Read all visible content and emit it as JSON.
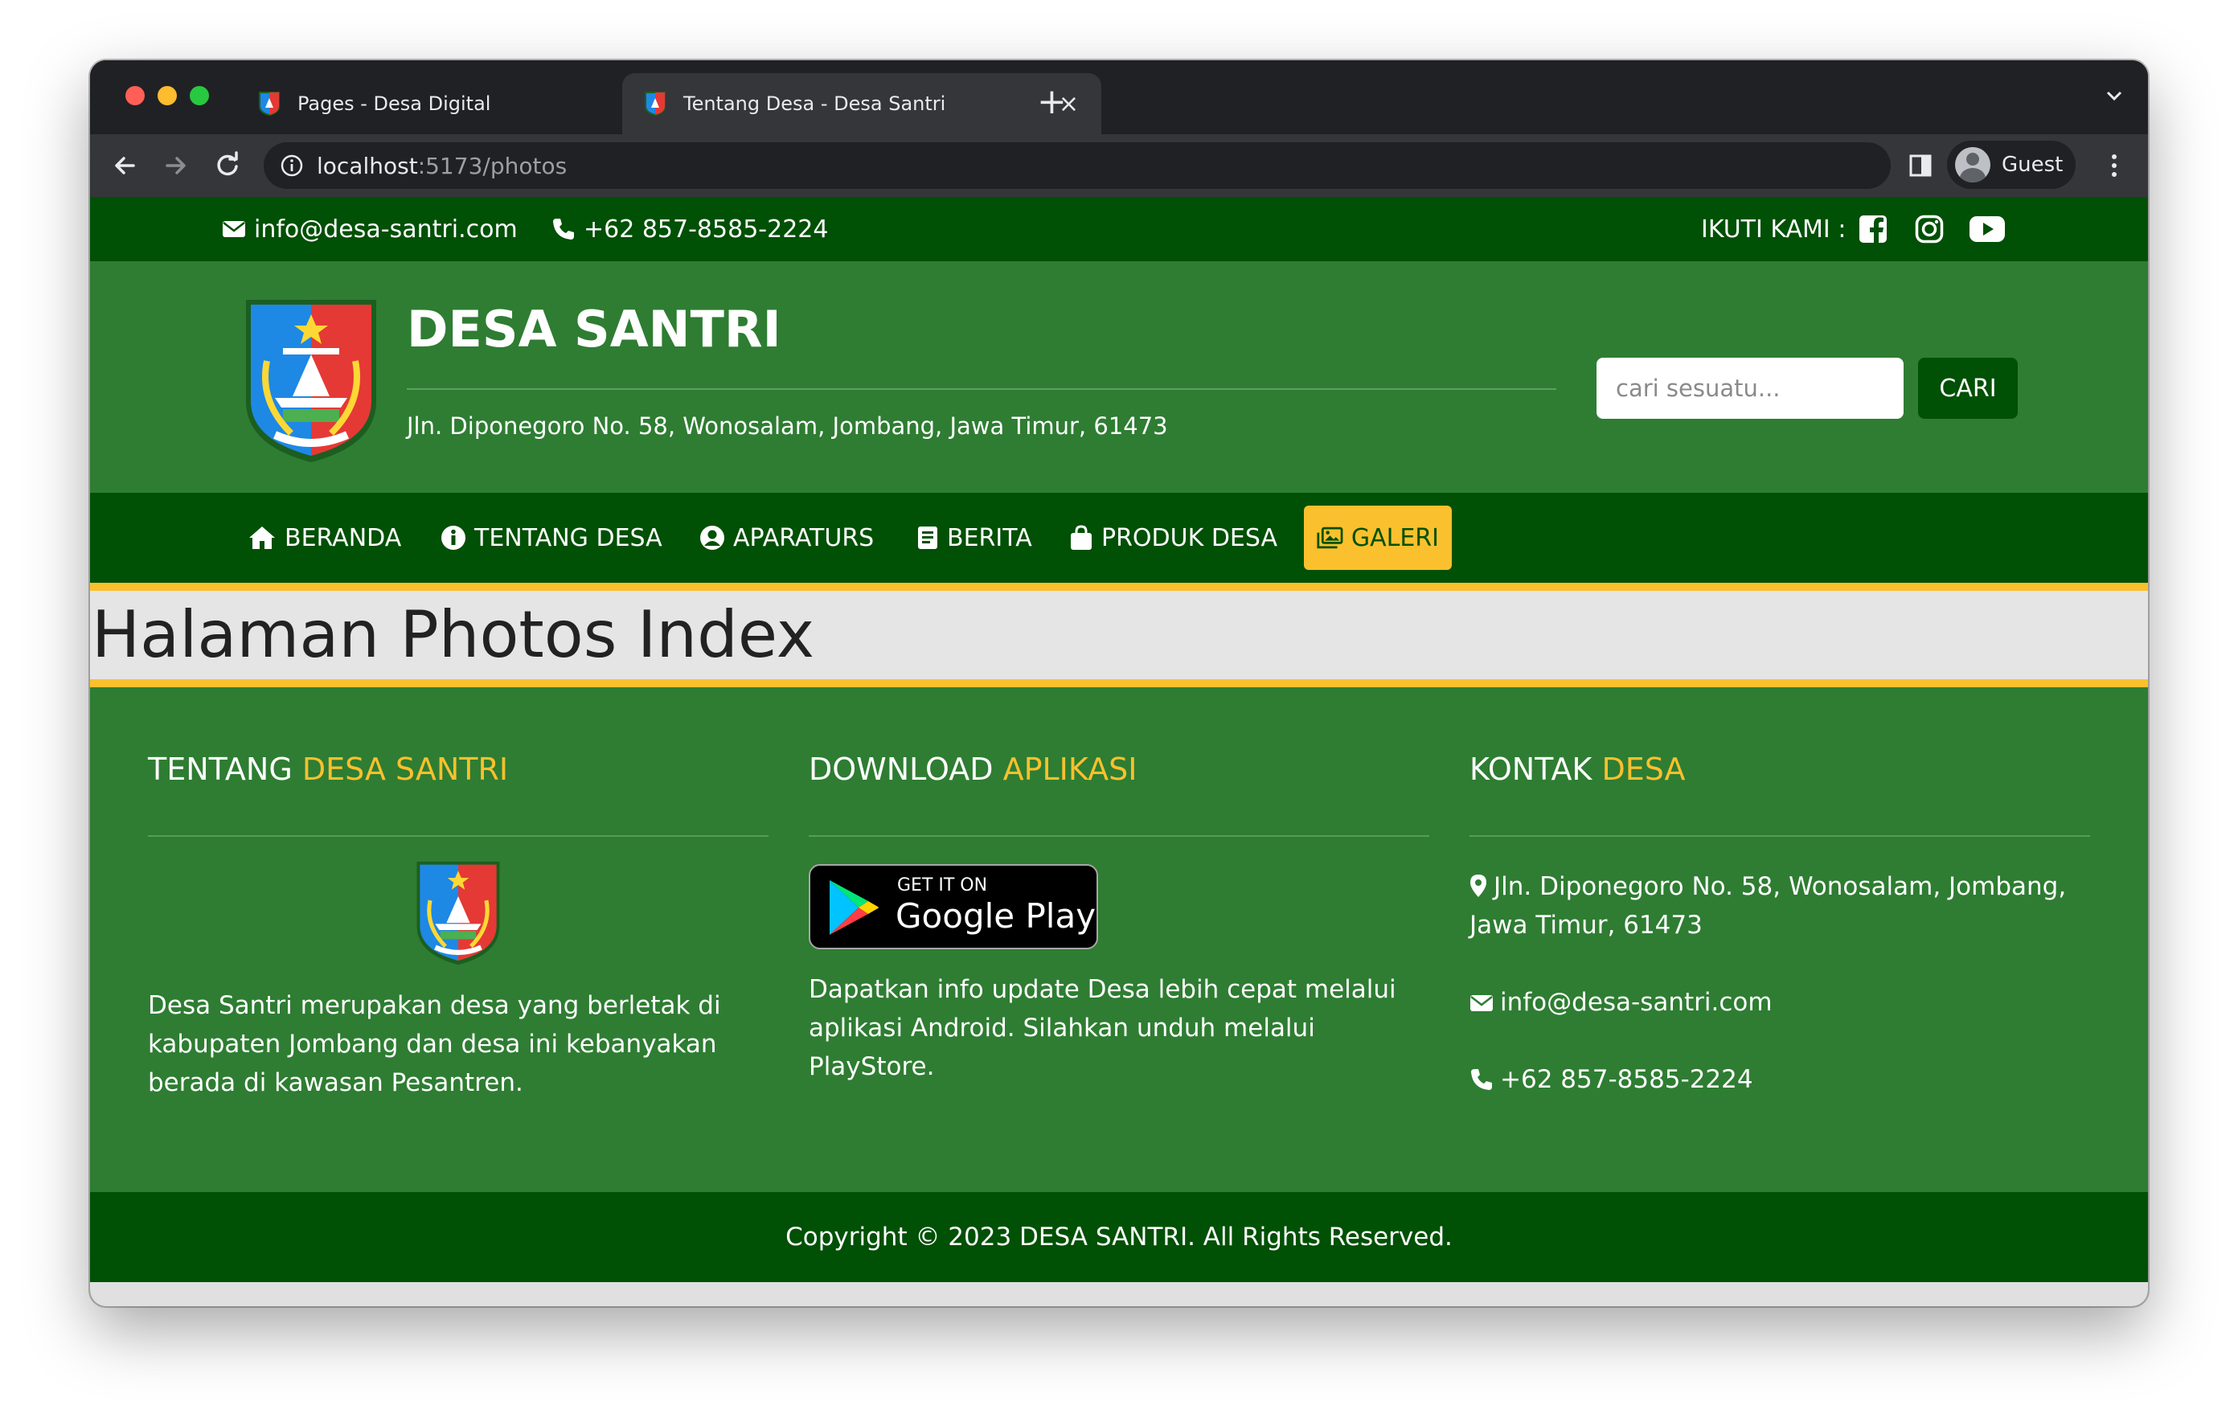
{
  "browser": {
    "tabs": [
      {
        "title": "Pages - Desa Digital"
      },
      {
        "title": "Tentang Desa - Desa Santri"
      }
    ],
    "url_host": "localhost",
    "url_path": ":5173/photos",
    "profile_name": "Guest"
  },
  "topbar": {
    "email": "info@desa-santri.com",
    "phone": "+62 857-8585-2224",
    "follow_label": "IKUTI KAMI :"
  },
  "header": {
    "site_name": "DESA SANTRI",
    "address": "Jln. Diponegoro No. 58, Wonosalam, Jombang, Jawa Timur, 61473",
    "search_placeholder": "cari sesuatu...",
    "search_button": "CARI"
  },
  "nav": {
    "items": [
      {
        "label": "BERANDA",
        "icon": "home-icon"
      },
      {
        "label": "TENTANG DESA",
        "icon": "info-icon"
      },
      {
        "label": "APARATURS",
        "icon": "user-circle-icon"
      },
      {
        "label": "BERITA",
        "icon": "newspaper-icon"
      },
      {
        "label": "PRODUK DESA",
        "icon": "shopping-bag-icon"
      },
      {
        "label": "GALERI",
        "icon": "images-icon",
        "active": true
      }
    ]
  },
  "main": {
    "title": "Halaman Photos Index"
  },
  "footer": {
    "about": {
      "heading_plain": "TENTANG ",
      "heading_highlight": "DESA SANTRI",
      "text": "Desa Santri merupakan desa yang berletak di kabupaten Jombang dan desa ini kebanyakan berada di kawasan Pesantren."
    },
    "download": {
      "heading_plain": "DOWNLOAD ",
      "heading_highlight": "APLIKASI",
      "badge_small": "GET IT ON",
      "badge_big": "Google Play",
      "text": "Dapatkan info update Desa lebih cepat melalui aplikasi Android. Silahkan unduh melalui PlayStore."
    },
    "contact": {
      "heading_plain": "KONTAK ",
      "heading_highlight": "DESA",
      "address": "Jln. Diponegoro No. 58, Wonosalam, Jombang, Jawa Timur, 61473",
      "email": "info@desa-santri.com",
      "phone": "+62 857-8585-2224"
    },
    "copyright": "Copyright © 2023 DESA SANTRI. All Rights Reserved."
  },
  "colors": {
    "dark_green": "#005005",
    "green": "#2e7d32",
    "accent_yellow": "#fbc02d"
  }
}
